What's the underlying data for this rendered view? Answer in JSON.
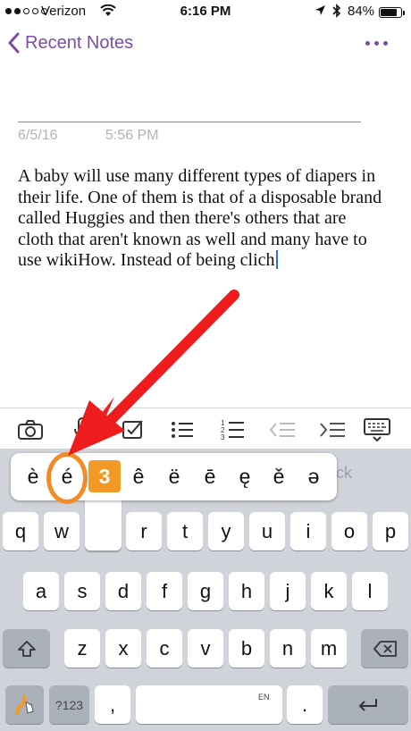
{
  "status_bar": {
    "carrier": "Verizon",
    "time": "6:16 PM",
    "battery": "84%"
  },
  "nav": {
    "back_label": "Recent Notes",
    "icons": [
      "chevron-left-icon",
      "more-dots-icon"
    ]
  },
  "note": {
    "date": "6/5/16",
    "time": "5:56 PM",
    "body": "A baby will use many different types of diapers in their life. One of them is that of a disposable brand called Huggies and then there's others that are cloth that aren't known as well and many have to use wikiHow. Instead of being clich"
  },
  "toolbar": {
    "icons": [
      "camera-icon",
      "microphone-icon",
      "checkbox-icon",
      "bulleted-list-icon",
      "numbered-list-icon",
      "outdent-icon",
      "indent-icon",
      "keyboard-hide-icon"
    ]
  },
  "keyboard": {
    "suggestion": "ick",
    "accent_popup": [
      "è",
      "é",
      "3",
      "ê",
      "ë",
      "ē",
      "ę",
      "ě",
      "ə"
    ],
    "rows": [
      [
        "q",
        "w",
        "",
        "r",
        "t",
        "y",
        "u",
        "i",
        "o",
        "p"
      ],
      [
        "a",
        "s",
        "d",
        "f",
        "g",
        "h",
        "j",
        "k",
        "l"
      ],
      [
        "z",
        "x",
        "c",
        "v",
        "b",
        "n",
        "m"
      ]
    ],
    "numbers_key": "?123",
    "comma_key": ",",
    "period_key": ".",
    "space_hint": "EN",
    "accent_color": "#f29a25",
    "brand_color": "#7b4da6"
  }
}
